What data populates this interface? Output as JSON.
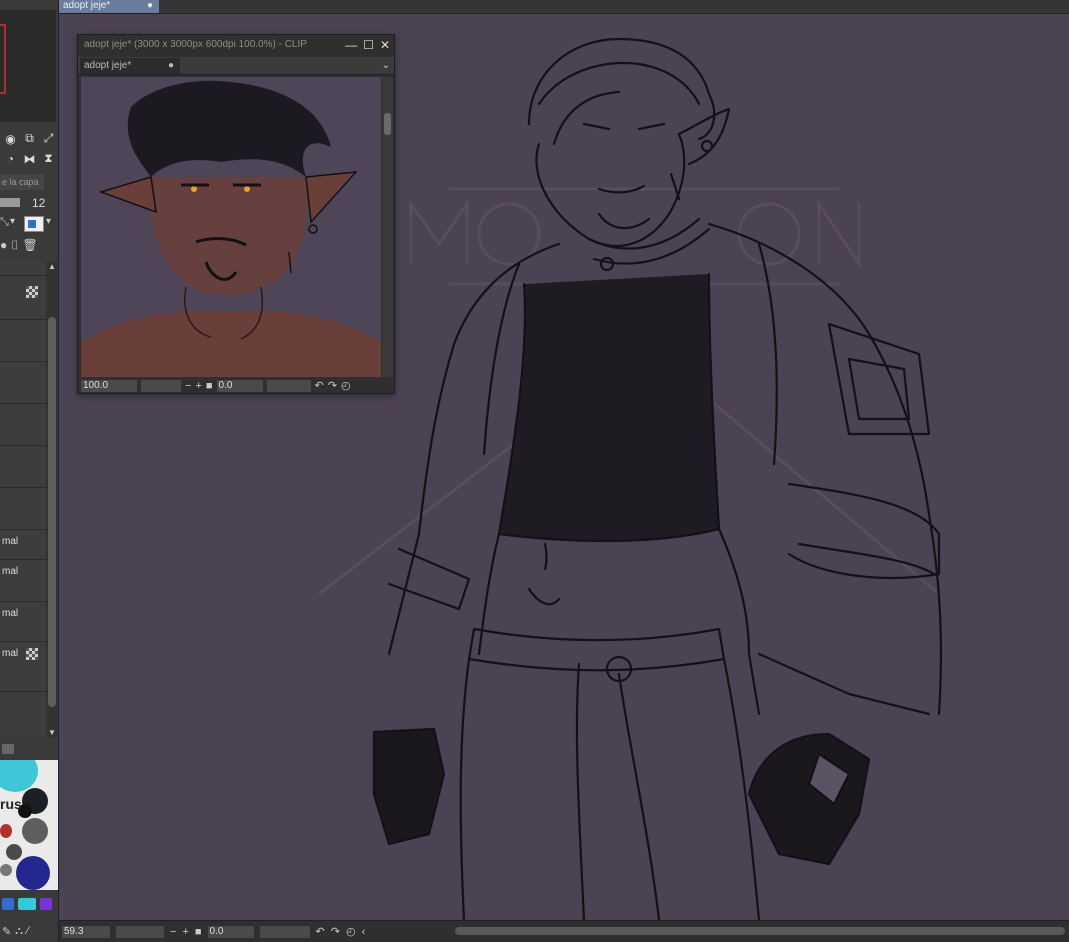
{
  "main_tab": {
    "label": "adopt jeje*",
    "close": "●"
  },
  "left_panel": {
    "layer_property_hint": "e la capa",
    "opacity_value": "12",
    "layers": [
      {
        "mode": ""
      },
      {
        "mode": ""
      },
      {
        "mode": ""
      },
      {
        "mode": ""
      },
      {
        "mode": ""
      },
      {
        "mode": ""
      },
      {
        "mode": "mal"
      },
      {
        "mode": "mal"
      },
      {
        "mode": "mal"
      },
      {
        "mode": "mal"
      }
    ],
    "palette_label": "rus"
  },
  "subwindow": {
    "title": "adopt jeje* (3000 x 3000px 600dpi 100.0%)  - CLIP",
    "tab_label": "adopt jeje*",
    "tab_marker": "●",
    "zoom_value": "100.0",
    "rotation_value": "0.0"
  },
  "status": {
    "zoom_value": "59.3",
    "rotation_value": "0.0"
  },
  "colors": {
    "canvas_bg": "#4b4253",
    "tab_active": "#6b7d9c",
    "accent_red": "#b22d2d"
  },
  "icons": [
    "minus-icon",
    "plus-icon",
    "fit-icon",
    "undo-rotate-icon",
    "redo-rotate-icon",
    "reset-icon",
    "close-icon",
    "maximize-icon",
    "minimize-icon",
    "chevron-down-icon"
  ]
}
